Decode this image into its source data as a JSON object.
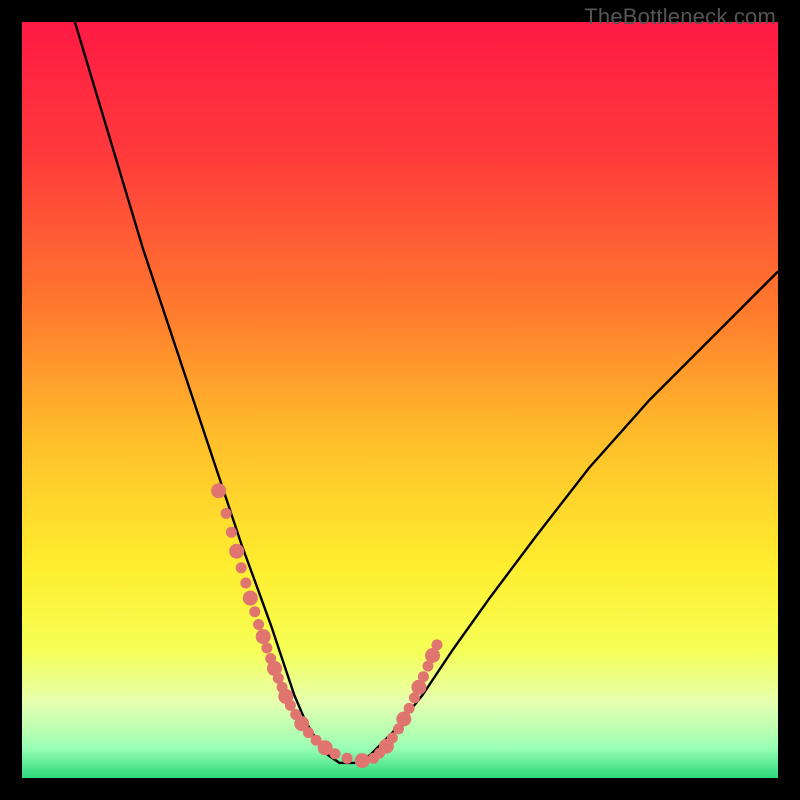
{
  "watermark": "TheBottleneck.com",
  "gradient": {
    "stops": [
      {
        "offset": 0.0,
        "color": "#ff1a44"
      },
      {
        "offset": 0.18,
        "color": "#ff3b3b"
      },
      {
        "offset": 0.38,
        "color": "#ff7a2e"
      },
      {
        "offset": 0.55,
        "color": "#ffbE2a"
      },
      {
        "offset": 0.72,
        "color": "#ffee2f"
      },
      {
        "offset": 0.83,
        "color": "#f6ff55"
      },
      {
        "offset": 0.9,
        "color": "#e6ffb0"
      },
      {
        "offset": 0.96,
        "color": "#9bffb4"
      },
      {
        "offset": 1.0,
        "color": "#2bd97a"
      }
    ]
  },
  "chart_data": {
    "type": "line",
    "title": "",
    "xlabel": "",
    "ylabel": "",
    "xlim": [
      0,
      100
    ],
    "ylim": [
      0,
      100
    ],
    "series": [
      {
        "name": "bottleneck-curve",
        "x": [
          7,
          10,
          13,
          16,
          19,
          22,
          25,
          27,
          29,
          31,
          33,
          34.5,
          36,
          37.5,
          39,
          40.5,
          42,
          44,
          46,
          49,
          53,
          57,
          62,
          68,
          75,
          83,
          92,
          100
        ],
        "y": [
          100,
          90,
          80,
          70,
          61,
          52,
          43,
          37,
          31,
          25.5,
          20,
          15.5,
          11,
          7.5,
          5,
          3,
          2,
          2,
          3,
          6,
          11,
          17,
          24,
          32,
          41,
          50,
          59,
          67
        ]
      }
    ],
    "markers": {
      "name": "highlight-dots",
      "color": "#e0746e",
      "x": [
        26,
        27,
        27.7,
        28.4,
        29.0,
        29.6,
        30.2,
        30.8,
        31.3,
        31.9,
        32.4,
        32.9,
        33.4,
        33.9,
        34.4,
        34.9,
        35.5,
        36.2,
        37.0,
        37.9,
        38.9,
        40.1,
        41.4,
        43.0,
        45.0,
        46.5,
        47.3,
        48.2,
        49.0,
        49.8,
        50.5,
        51.2,
        51.9,
        52.5,
        53.1,
        53.7,
        54.3,
        54.9
      ],
      "y": [
        38,
        35,
        32.5,
        30,
        27.8,
        25.8,
        23.8,
        22,
        20.3,
        18.7,
        17.2,
        15.8,
        14.5,
        13.2,
        12,
        10.8,
        9.6,
        8.4,
        7.2,
        6.0,
        5.0,
        4.0,
        3.2,
        2.6,
        2.3,
        2.6,
        3.3,
        4.2,
        5.3,
        6.5,
        7.8,
        9.2,
        10.6,
        12.0,
        13.4,
        14.8,
        16.2,
        17.6
      ]
    }
  }
}
